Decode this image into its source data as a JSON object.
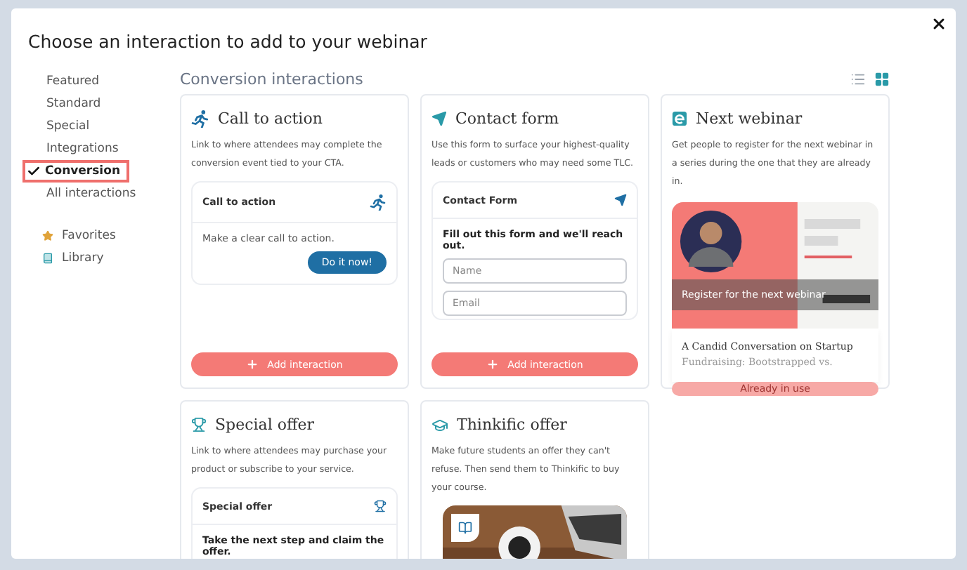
{
  "dialog": {
    "title": "Choose an interaction to add to your webinar"
  },
  "sidebar": {
    "categories": [
      {
        "label": "Featured",
        "selected": false
      },
      {
        "label": "Standard",
        "selected": false
      },
      {
        "label": "Special",
        "selected": false
      },
      {
        "label": "Integrations",
        "selected": false
      },
      {
        "label": "Conversion",
        "selected": true
      },
      {
        "label": "All interactions",
        "selected": false
      }
    ],
    "links": [
      {
        "label": "Favorites",
        "kind": "favorites"
      },
      {
        "label": "Library",
        "kind": "library"
      }
    ]
  },
  "main": {
    "heading": "Conversion interactions",
    "views": [
      {
        "kind": "list",
        "selected": false
      },
      {
        "kind": "grid",
        "selected": true
      }
    ]
  },
  "cards": [
    {
      "title": "Call to action",
      "description": "Link to where attendees may complete the conversion event tied to your CTA.",
      "preview": {
        "kind": "cta",
        "header": "Call to action",
        "text": "Make a clear call to action.",
        "action": "Do it now!"
      },
      "button": {
        "label": "Add interaction",
        "disabled": false
      }
    },
    {
      "title": "Contact form",
      "description": "Use this form to surface your highest-quality leads or customers who may need some TLC.",
      "preview": {
        "kind": "form",
        "header": "Contact Form",
        "text": "Fill out this form and we'll reach out.",
        "fields": [
          {
            "placeholder": "Name"
          },
          {
            "placeholder": "Email"
          }
        ]
      },
      "button": {
        "label": "Add interaction",
        "disabled": false
      }
    },
    {
      "title": "Next webinar",
      "description": "Get people to register for the next webinar in a series during the one that they are already in.",
      "preview": {
        "kind": "webinar",
        "overlay": "Register for the next webinar",
        "headline": "A Candid Conversation on Startup",
        "subline": "Fundraising: Bootstrapped vs."
      },
      "button": {
        "label": "Already in use",
        "disabled": true
      }
    },
    {
      "title": "Special offer",
      "description": "Link to where attendees may purchase your product or subscribe to your service.",
      "preview": {
        "kind": "offer",
        "header": "Special offer",
        "text": "Take the next step and claim the offer."
      }
    },
    {
      "title": "Thinkific offer",
      "description": "Make future students an offer they can't refuse. Then send them to Thinkific to buy your course."
    }
  ]
}
